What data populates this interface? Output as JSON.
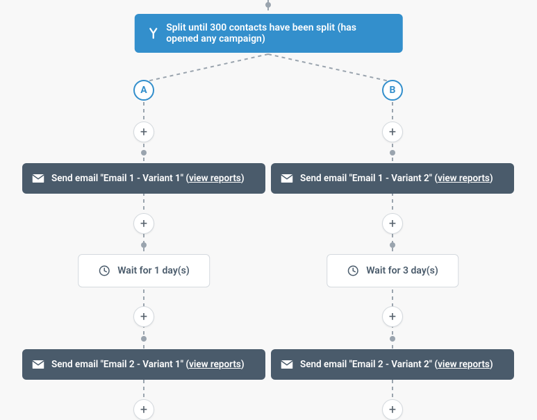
{
  "split": {
    "icon": "split-icon",
    "label": "Split until 300 contacts have been split (has opened any campaign)"
  },
  "branches": {
    "a": {
      "badge": "A",
      "email1": {
        "prefix": "Send email \"Email 1 - Variant 1\" (",
        "link": "view reports",
        "suffix": ")"
      },
      "wait": {
        "label": "Wait for 1 day(s)"
      },
      "email2": {
        "prefix": "Send email \"Email 2 - Variant 1\" (",
        "link": "view reports",
        "suffix": ")"
      }
    },
    "b": {
      "badge": "B",
      "email1": {
        "prefix": "Send email \"Email 1 - Variant 2\" (",
        "link": "view reports",
        "suffix": ")"
      },
      "wait": {
        "label": "Wait for 3 day(s)"
      },
      "email2": {
        "prefix": "Send email \"Email 2 - Variant 2\" (",
        "link": "view reports",
        "suffix": ")"
      }
    }
  },
  "plus_glyph": "+"
}
